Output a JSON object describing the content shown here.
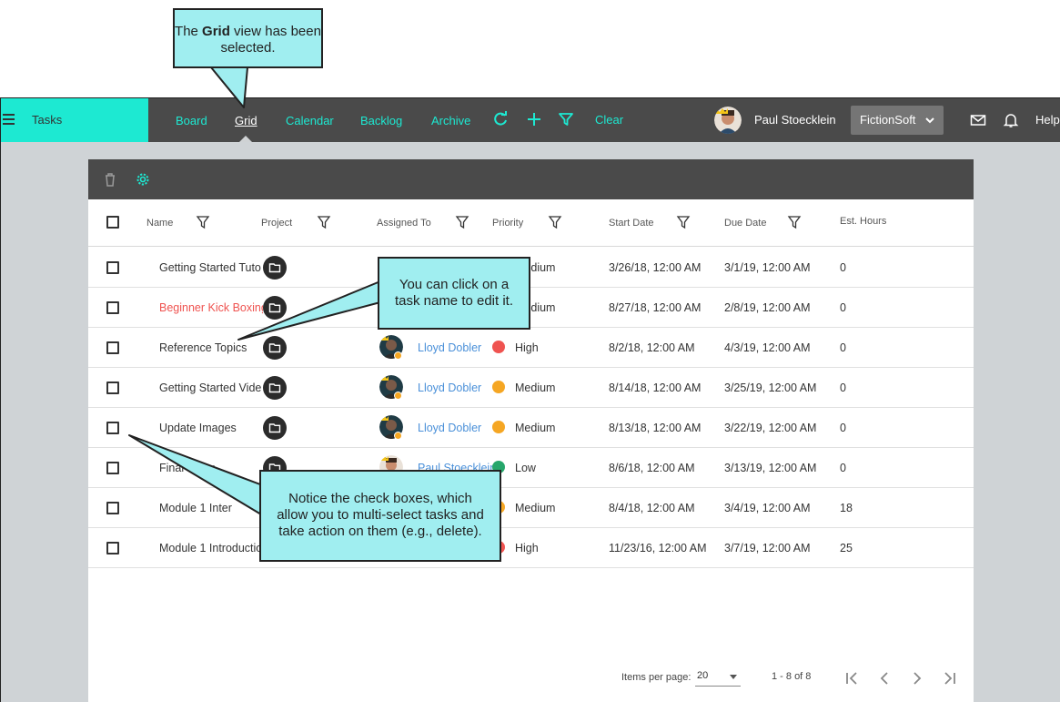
{
  "app": {
    "title": "Tasks",
    "nav": [
      "Board",
      "Grid",
      "Calendar",
      "Backlog",
      "Archive"
    ],
    "active_nav": "Grid",
    "clear_label": "Clear",
    "user_name": "Paul Stoecklein",
    "org": "FictionSoft",
    "help_label": "Help"
  },
  "grid": {
    "columns": [
      "Name",
      "Project",
      "Assigned To",
      "Priority",
      "Start Date",
      "Due Date",
      "Est. Hours"
    ],
    "rows": [
      {
        "name": "Getting Started Tuto",
        "assignee": "",
        "priority": "Medium",
        "priority_color": "#f5a623",
        "start": "3/26/18, 12:00 AM",
        "due": "3/1/19, 12:00 AM",
        "est": "0"
      },
      {
        "name": "Beginner Kick Boxing",
        "assignee": "",
        "priority": "Medium",
        "priority_color": "#f5a623",
        "start": "8/27/18, 12:00 AM",
        "due": "2/8/19, 12:00 AM",
        "est": "0"
      },
      {
        "name": "Reference Topics",
        "assignee": "Lloyd Dobler",
        "priority": "High",
        "priority_color": "#ef5350",
        "start": "8/2/18, 12:00 AM",
        "due": "4/3/19, 12:00 AM",
        "est": "0"
      },
      {
        "name": "Getting Started Vide",
        "assignee": "Lloyd Dobler",
        "priority": "Medium",
        "priority_color": "#f5a623",
        "start": "8/14/18, 12:00 AM",
        "due": "3/25/19, 12:00 AM",
        "est": "0"
      },
      {
        "name": "Update Images",
        "assignee": "Lloyd Dobler",
        "priority": "Medium",
        "priority_color": "#f5a623",
        "start": "8/13/18, 12:00 AM",
        "due": "3/22/19, 12:00 AM",
        "est": "0"
      },
      {
        "name": "Final Index",
        "assignee": "Paul Stoecklein",
        "priority": "Low",
        "priority_color": "#26a66b",
        "start": "8/6/18, 12:00 AM",
        "due": "3/13/19, 12:00 AM",
        "est": "0"
      },
      {
        "name": "Module 1 Inter",
        "assignee": "",
        "priority": "Medium",
        "priority_color": "#f5a623",
        "start": "8/4/18, 12:00 AM",
        "due": "3/4/19, 12:00 AM",
        "est": "18"
      },
      {
        "name": "Module 1 Introductio",
        "assignee": "",
        "priority": "High",
        "priority_color": "#ef5350",
        "start": "11/23/16, 12:00 AM",
        "due": "3/7/19, 12:00 AM",
        "est": "25"
      }
    ],
    "items_per_page_label": "Items per page:",
    "items_per_page": "20",
    "range": "1 - 8 of 8"
  },
  "callouts": {
    "grid_prefix": "The ",
    "grid_bold": "Grid",
    "grid_suffix": " view has been selected.",
    "task_name": "You can click on a task name to edit it.",
    "checkboxes": "Notice the check boxes, which allow you to multi-select tasks and take action on them (e.g., delete)."
  },
  "colors": {
    "accent": "#1de9d2",
    "nav_bg": "#4a4a4a",
    "callout_bg": "#a0eef0"
  }
}
